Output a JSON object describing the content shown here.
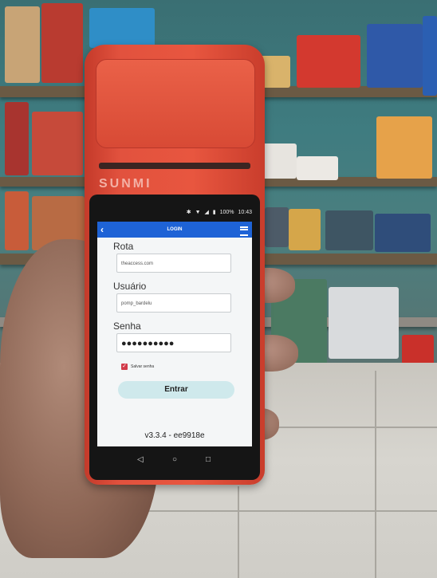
{
  "device": {
    "brand": "SUNMI"
  },
  "status_bar": {
    "battery": "100%",
    "time": "10:43"
  },
  "app_bar": {
    "title": "LOGIN"
  },
  "form": {
    "rota_label": "Rota",
    "rota_value": "theaccess.com",
    "usuario_label": "Usuário",
    "usuario_value": "pomp_bardelu",
    "senha_label": "Senha",
    "senha_value": "●●●●●●●●●●",
    "save_password_label": "Salvar senha",
    "save_password_checked": true,
    "submit_label": "Entrar"
  },
  "version": "v3.3.4 - ee9918e",
  "nav": {
    "back": "◁",
    "home": "○",
    "recents": "□"
  },
  "colors": {
    "app_bar": "#1e63d6",
    "device_body": "#e2523e",
    "button": "#cfe9ec",
    "checkbox": "#d23b4a"
  }
}
